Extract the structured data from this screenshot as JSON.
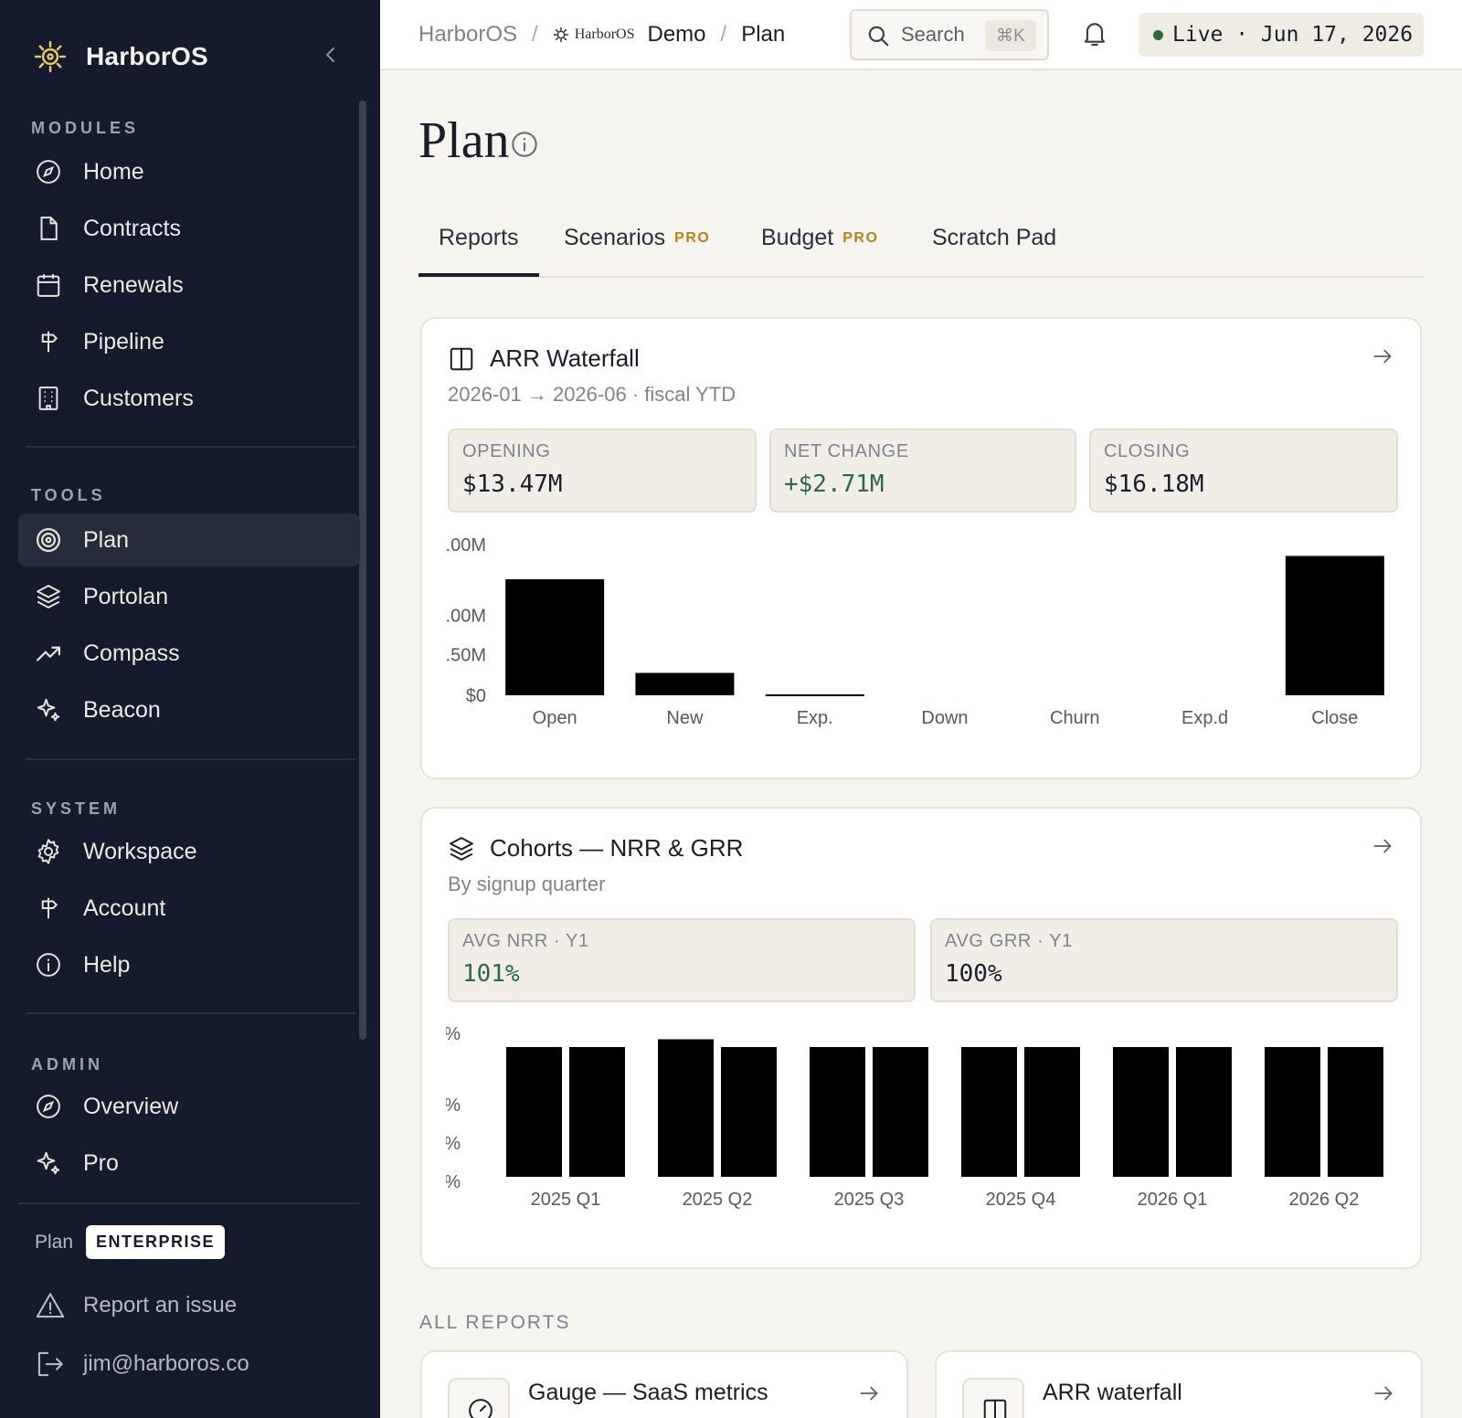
{
  "sidebar": {
    "brand": "HarborOS",
    "sections": [
      {
        "label": "MODULES",
        "items": [
          {
            "label": "Home",
            "icon": "compass-icon"
          },
          {
            "label": "Contracts",
            "icon": "file-icon"
          },
          {
            "label": "Renewals",
            "icon": "calendar-icon"
          },
          {
            "label": "Pipeline",
            "icon": "signpost-icon"
          },
          {
            "label": "Customers",
            "icon": "building-icon"
          }
        ]
      },
      {
        "label": "TOOLS",
        "items": [
          {
            "label": "Plan",
            "icon": "target-icon",
            "active": true
          },
          {
            "label": "Portolan",
            "icon": "layers-icon"
          },
          {
            "label": "Compass",
            "icon": "trending-up-icon"
          },
          {
            "label": "Beacon",
            "icon": "sparkle-icon"
          }
        ]
      },
      {
        "label": "SYSTEM",
        "items": [
          {
            "label": "Workspace",
            "icon": "gear-icon"
          },
          {
            "label": "Account",
            "icon": "signpost-icon"
          },
          {
            "label": "Help",
            "icon": "info-icon"
          }
        ]
      },
      {
        "label": "ADMIN",
        "items": [
          {
            "label": "Overview",
            "icon": "compass-icon"
          },
          {
            "label": "Pro",
            "icon": "sparkle-icon"
          }
        ]
      }
    ],
    "plan_label": "Plan",
    "plan_badge": "ENTERPRISE",
    "report_issue": "Report an issue",
    "user_email": "jim@harboros.co"
  },
  "topbar": {
    "breadcrumb": [
      "HarborOS",
      "Demo",
      "Plan"
    ],
    "breadcrumb_logo_text": "HarborOS",
    "search_label": "Search",
    "search_shortcut": "⌘K",
    "live_text": "Live · Jun 17, 2026",
    "live_color": "#2e6a3a"
  },
  "page": {
    "title": "Plan",
    "tabs": [
      {
        "label": "Reports",
        "pro": "",
        "active": true
      },
      {
        "label": "Scenarios",
        "pro": "PRO"
      },
      {
        "label": "Budget",
        "pro": "PRO"
      },
      {
        "label": "Scratch Pad",
        "pro": ""
      }
    ]
  },
  "arr_card": {
    "title": "ARR Waterfall",
    "subtitle": "2026-01 → 2026-06 · fiscal YTD",
    "stats": [
      {
        "label": "OPENING",
        "value": "$13.47M"
      },
      {
        "label": "NET CHANGE",
        "value": "+$2.71M"
      },
      {
        "label": "CLOSING",
        "value": "$16.18M"
      }
    ]
  },
  "cohort_card": {
    "title": "Cohorts — NRR & GRR",
    "subtitle": "By signup quarter",
    "stats": [
      {
        "label": "AVG NRR · Y1",
        "value": "101%"
      },
      {
        "label": "AVG GRR · Y1",
        "value": "100%"
      }
    ]
  },
  "all_reports": {
    "caption": "ALL REPORTS",
    "items": [
      {
        "title": "Gauge — SaaS metrics",
        "icon": "gauge-icon"
      },
      {
        "title": "ARR waterfall",
        "icon": "columns-icon"
      }
    ]
  },
  "chart_data": [
    {
      "type": "bar",
      "categories": [
        "Open",
        "New",
        "Exp.",
        "Down",
        "Churn",
        "Exp.d",
        "Close"
      ],
      "values": [
        13.47,
        2.6,
        0.11,
        0,
        0,
        0,
        16.18
      ],
      "ytick_labels": [
        ".00M",
        ".00M",
        ".50M",
        "$0"
      ],
      "ytick_values": [
        17.5,
        9.3,
        4.7,
        0
      ],
      "ylim": [
        0,
        17.5
      ],
      "bar_color": "#000000"
    },
    {
      "type": "bar",
      "categories": [
        "2025 Q1",
        "2025 Q2",
        "2025 Q3",
        "2025 Q4",
        "2026 Q1",
        "2026 Q2"
      ],
      "series": [
        {
          "values": [
            100,
            106,
            100,
            100,
            100,
            100
          ]
        },
        {
          "values": [
            100,
            100,
            100,
            100,
            100,
            100
          ]
        }
      ],
      "ytick_labels": [
        "%",
        "%",
        "%",
        "%"
      ],
      "bar_color": "#000000"
    }
  ]
}
